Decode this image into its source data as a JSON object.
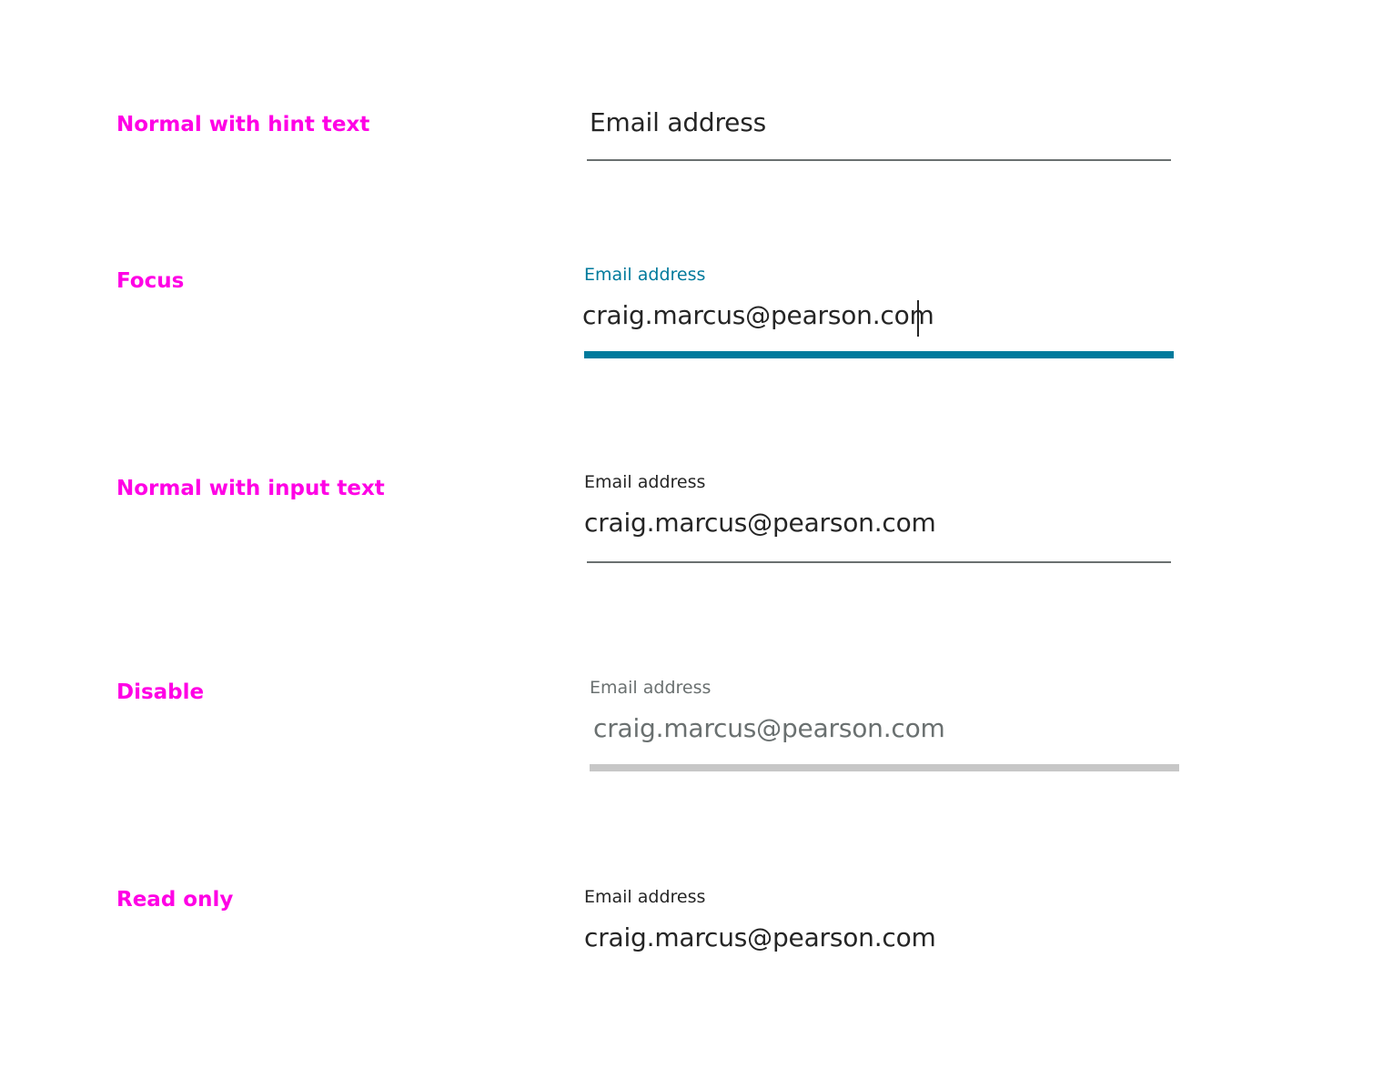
{
  "colors": {
    "state_label": "#ff00e5",
    "text_primary": "#252525",
    "text_disabled": "#6a7070",
    "focus_accent": "#007a9c",
    "underline_normal": "#6a7070",
    "underline_disabled": "#c7c7c7"
  },
  "states": [
    {
      "name": "Normal with hint text",
      "field": {
        "hint": "Email address"
      }
    },
    {
      "name": "Focus",
      "field": {
        "label": "Email address",
        "value": "craig.marcus@pearson.com"
      }
    },
    {
      "name": "Normal with input text",
      "field": {
        "label": "Email address",
        "value": "craig.marcus@pearson.com"
      }
    },
    {
      "name": "Disable",
      "field": {
        "label": "Email address",
        "value": "craig.marcus@pearson.com"
      }
    },
    {
      "name": "Read only",
      "field": {
        "label": "Email address",
        "value": "craig.marcus@pearson.com"
      }
    }
  ]
}
